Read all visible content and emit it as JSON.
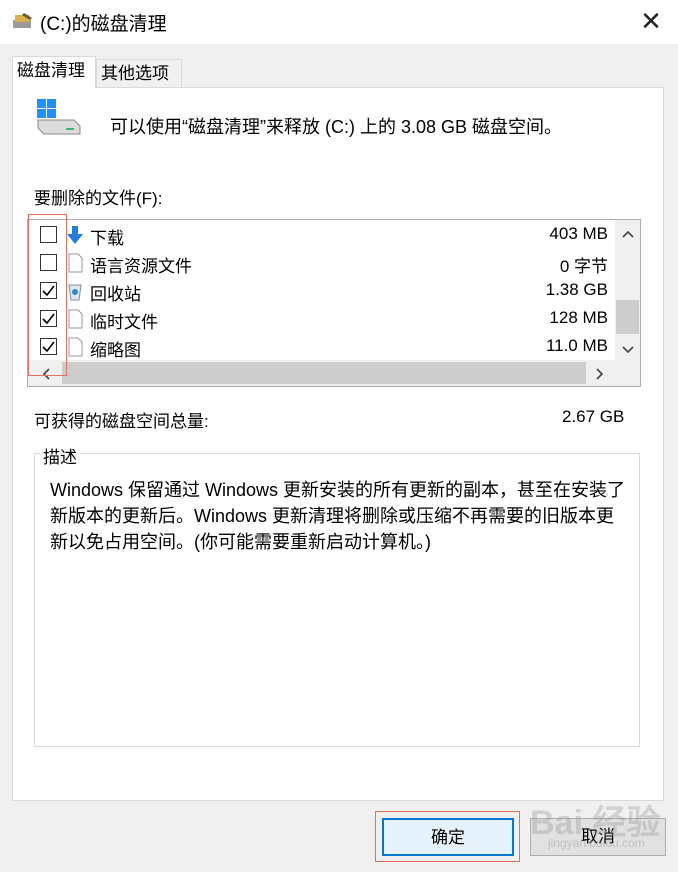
{
  "window": {
    "title": "(C:)的磁盘清理",
    "close_glyph": "✕"
  },
  "tabs": [
    {
      "label": "磁盘清理",
      "active": true
    },
    {
      "label": "其他选项",
      "active": false
    }
  ],
  "info_text": "可以使用“磁盘清理”来释放 (C:) 上的 3.08 GB 磁盘空间。",
  "files_label": "要删除的文件(F):",
  "files": [
    {
      "name": "下载",
      "size": "403 MB",
      "checked": false,
      "icon": "download-arrow-icon"
    },
    {
      "name": "语言资源文件",
      "size": "0 字节",
      "checked": false,
      "icon": "file-icon"
    },
    {
      "name": "回收站",
      "size": "1.38 GB",
      "checked": true,
      "icon": "recycle-bin-icon"
    },
    {
      "name": "临时文件",
      "size": "128 MB",
      "checked": true,
      "icon": "file-icon"
    },
    {
      "name": "缩略图",
      "size": "11.0 MB",
      "checked": true,
      "icon": "file-icon"
    }
  ],
  "space_label": "可获得的磁盘空间总量:",
  "space_value": "2.67 GB",
  "description": {
    "title": "描述",
    "text": "Windows 保留通过 Windows 更新安装的所有更新的副本，甚至在安装了新版本的更新后。Windows 更新清理将删除或压缩不再需要的旧版本更新以免占用空间。(你可能需要重新启动计算机。)"
  },
  "buttons": {
    "ok": "确定",
    "cancel": "取消"
  },
  "watermark": {
    "main": "Bai 经验",
    "sub": "jingyan.baidu.com"
  },
  "colors": {
    "highlight_box": "#e0735c",
    "accent": "#0078d7"
  }
}
